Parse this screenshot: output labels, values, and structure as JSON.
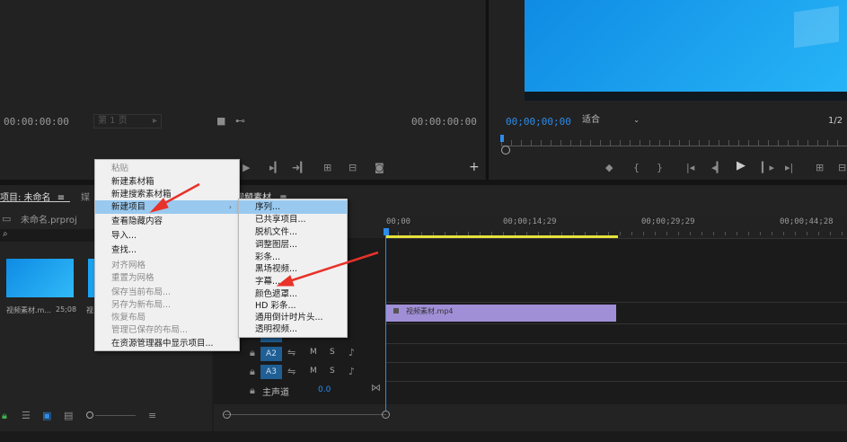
{
  "source_monitor": {
    "timecode_left": "00:00:00:00",
    "timecode_right": "00:00:00:00",
    "dropdown": "第 1 页"
  },
  "program_monitor": {
    "timecode": "00;00;00;00",
    "fit_label": "适合",
    "ratio": "1/2"
  },
  "project_panel": {
    "title": "项目: 未命名",
    "second_tab": "媒",
    "file_name": "未命名.prproj",
    "thumb1_label": "视频素材.m...",
    "thumb1_duration": "25;08",
    "thumb2_label": "视"
  },
  "timeline": {
    "tab": "视频素材",
    "ruler": [
      "00;00",
      "00;00;14;29",
      "00;00;29;29",
      "00;00;44;28"
    ],
    "clip_label": "视频素材.mp4",
    "tracks": [
      {
        "name": "A1"
      },
      {
        "name": "A2"
      },
      {
        "name": "A3"
      }
    ],
    "track_letters": {
      "m": "M",
      "s": "S"
    },
    "master": {
      "label": "主声道",
      "value": "0.0"
    }
  },
  "context_menu": {
    "items": [
      {
        "label": "粘贴",
        "disabled": true
      },
      {
        "label": "新建素材箱",
        "disabled": false
      },
      {
        "label": "新建搜索素材箱",
        "disabled": false
      },
      {
        "label": "新建项目",
        "disabled": false,
        "highlighted": true
      },
      {
        "label": "查看隐藏内容",
        "disabled": false
      },
      {
        "label": "导入...",
        "disabled": false
      },
      {
        "label": "查找...",
        "disabled": false
      },
      {
        "label": "对齐网格",
        "disabled": true
      },
      {
        "label": "重置为网格",
        "disabled": true
      },
      {
        "label": "保存当前布局...",
        "disabled": true
      },
      {
        "label": "另存为新布局...",
        "disabled": true
      },
      {
        "label": "恢复布局",
        "disabled": true
      },
      {
        "label": "管理已保存的布局...",
        "disabled": true
      },
      {
        "label": "在资源管理器中显示项目...",
        "disabled": false
      }
    ]
  },
  "submenu": {
    "items": [
      {
        "label": "序列...",
        "highlighted": true
      },
      {
        "label": "已共享项目..."
      },
      {
        "label": "脱机文件..."
      },
      {
        "label": "调整图层..."
      },
      {
        "label": "彩条..."
      },
      {
        "label": "黑场视频..."
      },
      {
        "label": "字幕..."
      },
      {
        "label": "颜色遮罩..."
      },
      {
        "label": "HD 彩条..."
      },
      {
        "label": "通用倒计时片头..."
      },
      {
        "label": "透明视频..."
      }
    ]
  },
  "colors": {
    "accent": "#2d8ceb",
    "highlight": "#99c9ef",
    "clip": "#a08fd6",
    "arrow": "#e8322a",
    "preview": "#1aa3f0"
  }
}
